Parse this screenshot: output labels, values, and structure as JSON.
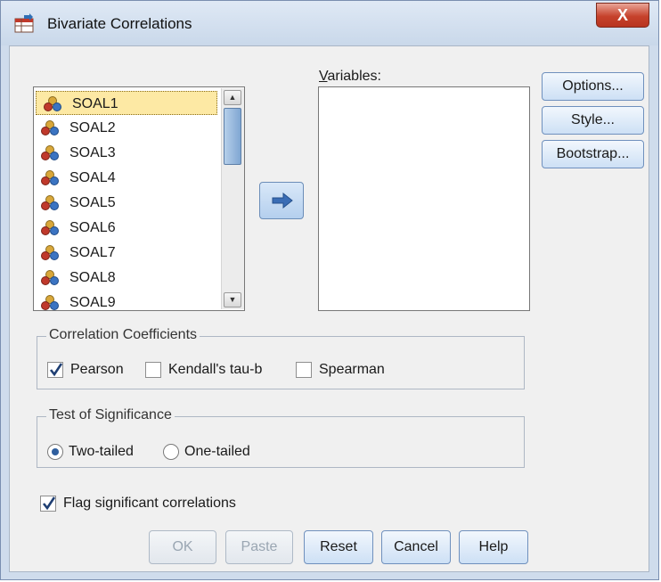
{
  "window": {
    "title": "Bivariate Correlations",
    "close_label": "X"
  },
  "source_list": {
    "items": [
      "SOAL1",
      "SOAL2",
      "SOAL3",
      "SOAL4",
      "SOAL5",
      "SOAL6",
      "SOAL7",
      "SOAL8",
      "SOAL9"
    ],
    "selected": "SOAL1",
    "item_icon": "scale-variable-icon"
  },
  "variables": {
    "label": "Variables:",
    "items": []
  },
  "side_buttons": {
    "options": "Options...",
    "style": "Style...",
    "bootstrap": "Bootstrap..."
  },
  "correlation": {
    "title": "Correlation Coefficients",
    "pearson": {
      "label": "Pearson",
      "checked": true
    },
    "kendall": {
      "label": "Kendall's tau-b",
      "checked": false
    },
    "spearman": {
      "label": "Spearman",
      "checked": false
    }
  },
  "significance": {
    "title": "Test of Significance",
    "two_tailed": {
      "label": "Two-tailed",
      "selected": true
    },
    "one_tailed": {
      "label": "One-tailed",
      "selected": false
    }
  },
  "flag": {
    "label": "Flag significant correlations",
    "checked": true
  },
  "bottom_buttons": {
    "ok": "OK",
    "paste": "Paste",
    "reset": "Reset",
    "cancel": "Cancel",
    "help": "Help"
  },
  "colors": {
    "selection_bg": "#fde9a4",
    "accent": "#2f5f9e",
    "close_red": "#c6422c"
  }
}
